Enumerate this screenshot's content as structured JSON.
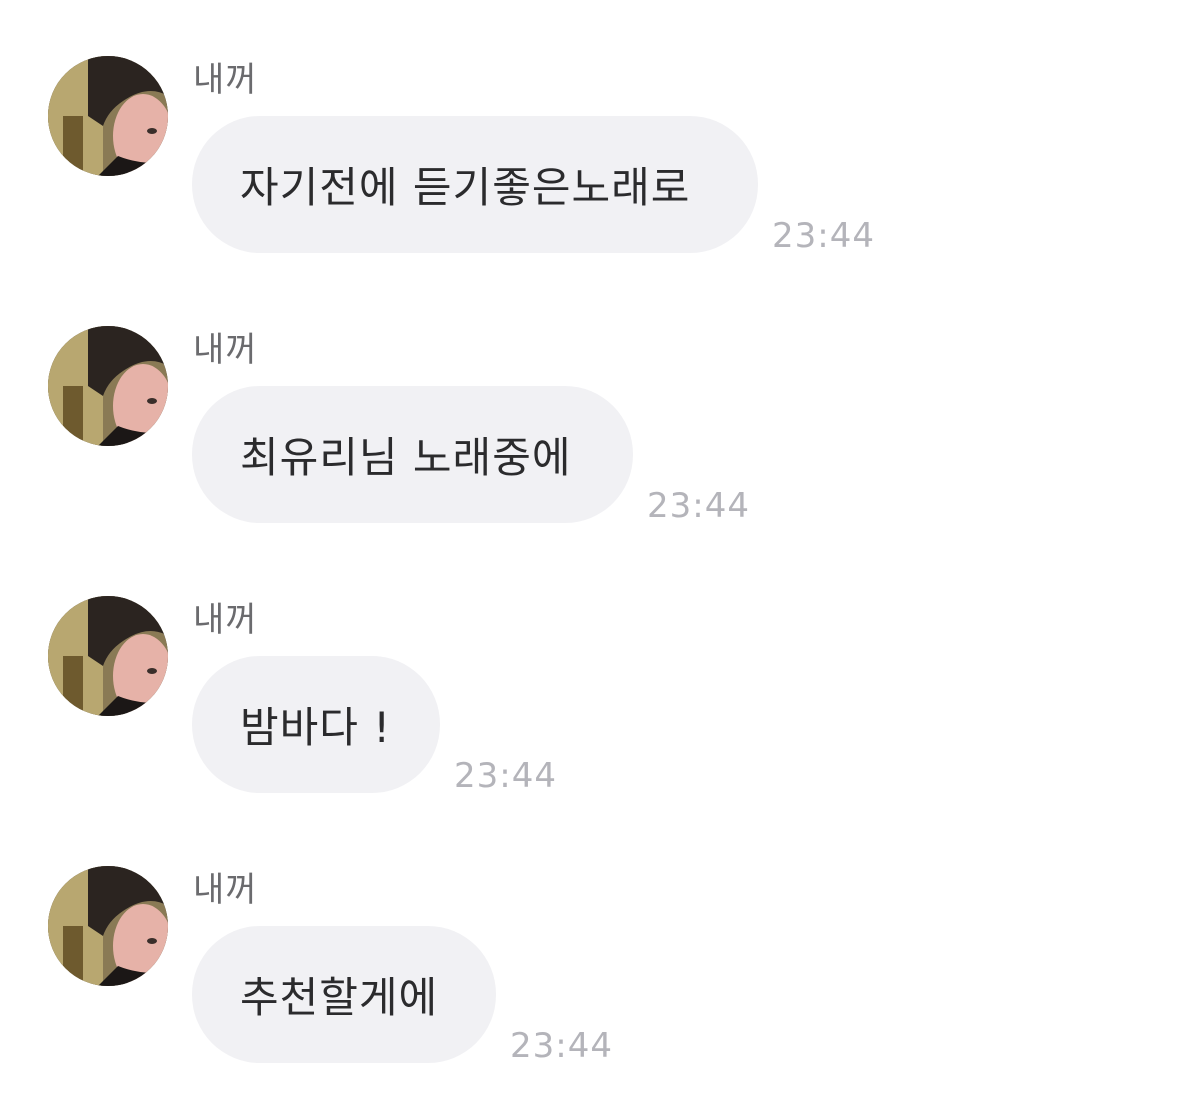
{
  "messages": [
    {
      "sender": "내꺼",
      "text": "자기전에 듣기좋은노래로",
      "time": "23:44",
      "avatar_icon": "profile-photo"
    },
    {
      "sender": "내꺼",
      "text": "최유리님 노래중에",
      "time": "23:44",
      "avatar_icon": "profile-photo"
    },
    {
      "sender": "내꺼",
      "text": "밤바다 !",
      "time": "23:44",
      "avatar_icon": "profile-photo"
    },
    {
      "sender": "내꺼",
      "text": "추천할게에",
      "time": "23:44",
      "avatar_icon": "profile-photo"
    }
  ],
  "colors": {
    "bubble": "#f1f1f4",
    "text": "#2b2b2d",
    "sender": "#6b6b6e",
    "time": "#b4b4ba"
  }
}
